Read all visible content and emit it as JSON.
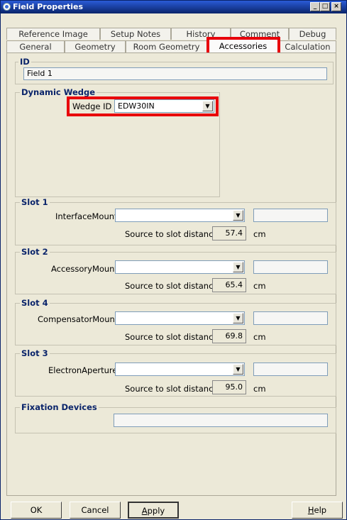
{
  "window": {
    "title": "Field Properties",
    "minimize": "_",
    "maximize": "□",
    "close": "×"
  },
  "tabs_row1": [
    "Reference Image",
    "Setup Notes",
    "History",
    "Comment",
    "Debug"
  ],
  "tabs_row2": [
    "General",
    "Geometry",
    "Room Geometry",
    "Accessories",
    "Calculation"
  ],
  "active_tab": "Accessories",
  "id_group": {
    "title": "ID",
    "value": "Field 1"
  },
  "wedge_group": {
    "title": "Dynamic Wedge",
    "label": "Wedge ID",
    "value": "EDW30IN"
  },
  "slots": [
    {
      "title": "Slot 1",
      "mount_label": "InterfaceMount",
      "distance_label": "Source to slot distance",
      "distance": "57.4",
      "unit": "cm"
    },
    {
      "title": "Slot 2",
      "mount_label": "AccessoryMount",
      "distance_label": "Source to slot distance",
      "distance": "65.4",
      "unit": "cm"
    },
    {
      "title": "Slot 4",
      "mount_label": "CompensatorMount",
      "distance_label": "Source to slot distance",
      "distance": "69.8",
      "unit": "cm"
    },
    {
      "title": "Slot 3",
      "mount_label": "ElectronAperture",
      "distance_label": "Source to slot distance",
      "distance": "95.0",
      "unit": "cm"
    }
  ],
  "fixation": {
    "title": "Fixation Devices"
  },
  "buttons": {
    "ok": "OK",
    "cancel": "Cancel",
    "apply_first": "A",
    "apply_rest": "pply",
    "help_first": "H",
    "help_rest": "elp"
  },
  "colors": {
    "highlight": "#e8000b",
    "group_title": "#0a246a"
  }
}
